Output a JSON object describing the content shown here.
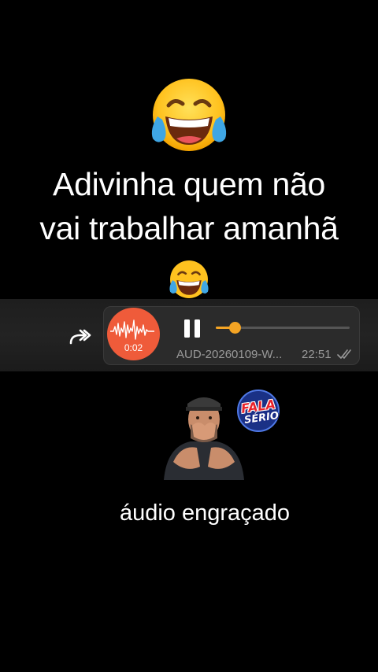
{
  "overlay": {
    "headline_line1": "Adivinha quem não",
    "headline_line2": "vai trabalhar amanhã",
    "caption": "áudio engraçado"
  },
  "audio_message": {
    "duration": "0:02",
    "file_name": "AUD-20260109-W...",
    "time": "22:51",
    "progress": 0.14,
    "status": "read"
  },
  "badge": {
    "word1": "FALA",
    "word2": "SÉRIO"
  },
  "colors": {
    "accent_orange": "#ef5b3a",
    "seek_yellow": "#f4a424",
    "bubble_bg": "#2b2b2b",
    "meta_gray": "#9a9a9a"
  },
  "icons": [
    "laughing-tears-emoji",
    "forward-icon",
    "pause-icon",
    "double-check-icon"
  ]
}
